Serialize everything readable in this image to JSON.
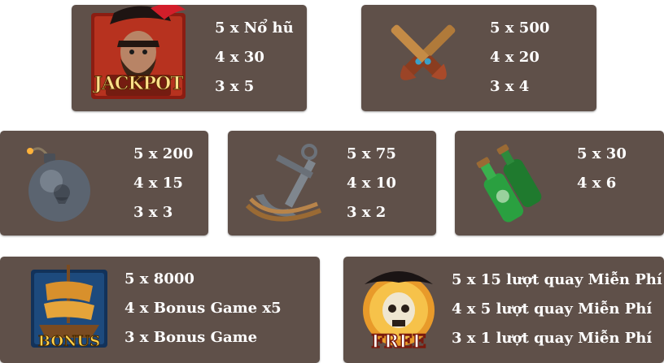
{
  "paytable": [
    {
      "symbol": "jackpot-pirate-captain",
      "badge": "JACKPOT",
      "lines": [
        "5 x Nổ hũ",
        "4 x 30",
        "3 x 5"
      ]
    },
    {
      "symbol": "crossed-pistols",
      "lines": [
        "5 x 500",
        "4 x 20",
        "3 x 4"
      ]
    },
    {
      "symbol": "bomb",
      "lines": [
        "5 x 200",
        "4 x 15",
        "3 x 3"
      ]
    },
    {
      "symbol": "anchor",
      "lines": [
        "5 x 75",
        "4 x 10",
        "3 x 2"
      ]
    },
    {
      "symbol": "rum-bottles",
      "lines": [
        "5 x 30",
        "4 x 6"
      ]
    },
    {
      "symbol": "bonus-ship",
      "badge": "BONUS",
      "lines": [
        "5 x 8000",
        "4 x Bonus Game x5",
        "3 x Bonus Game"
      ]
    },
    {
      "symbol": "free-skull",
      "badge": "FREE",
      "lines": [
        "5 x 15 lượt quay Miễn Phí",
        "4 x 5 lượt quay Miễn Phí",
        "3 x 1 lượt quay Miễn Phí"
      ]
    }
  ],
  "colors": {
    "card": "#5f5049",
    "text": "#ffffff"
  }
}
